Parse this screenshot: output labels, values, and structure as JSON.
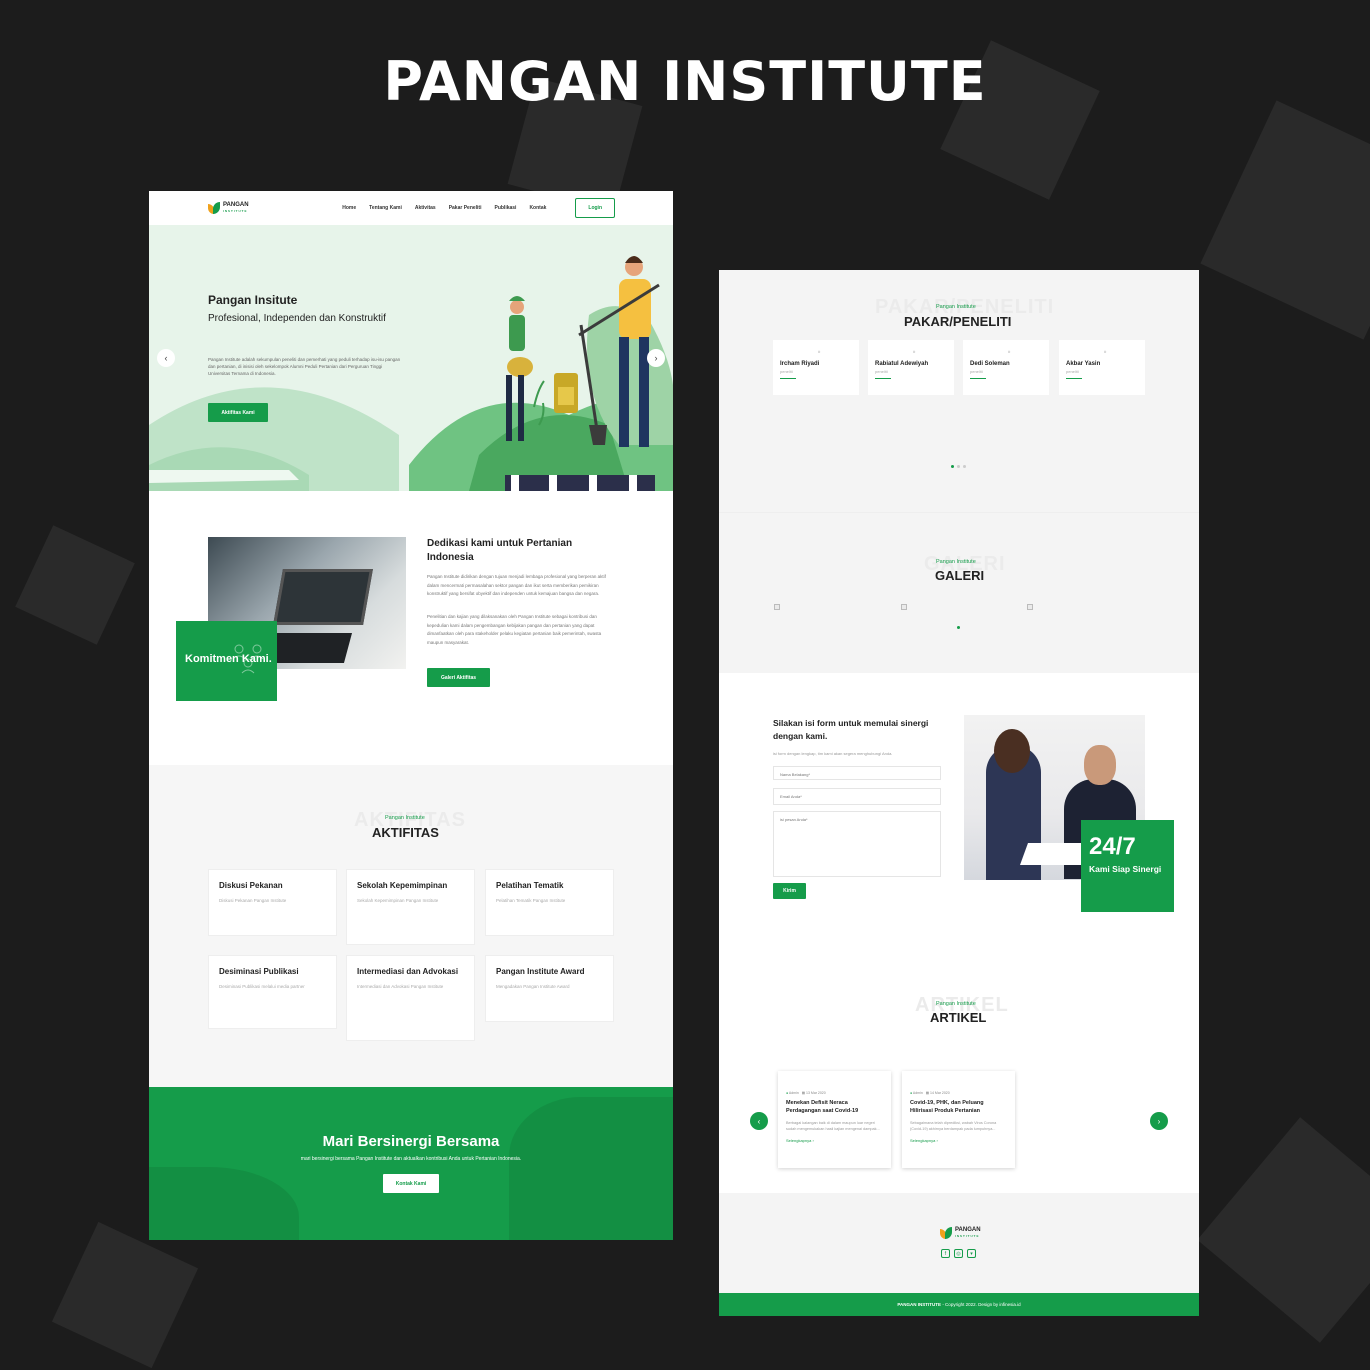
{
  "title": "PANGAN INSTITUTE",
  "nav": {
    "logo": "PANGAN",
    "logo_sub": "INSTITUTE",
    "items": [
      "Home",
      "Tentang Kami",
      "Aktivitas",
      "Pakar Peneliti",
      "Publikasi",
      "Kontak"
    ],
    "login": "Login"
  },
  "hero": {
    "title": "Pangan Insitute",
    "subtitle": "Profesional, Independen dan Konstruktif",
    "body": "Pangan Institute adalah sekumpulan peneliti dan pemerhati yang peduli terhadap isu-isu pangan dan pertanian, di inisisi oleh sekelompok Alumni Peduli Pertanian dari Perguruan Tinggi Universitas Ternama di Indonesia.",
    "button": "Aktifitas Kami"
  },
  "about": {
    "badge": "Komitmen Kami.",
    "title": "Dedikasi kami untuk Pertanian Indonesia",
    "p1": "Pangan Institute didirikan dengan tujuan menjadi lembaga profesional yang berperan aktif dalam mencermati permasalahan sektor pangan dan ikut serta memberikan pemikiran konstruktif yang bersifat obyektif dan independen untuk kemajuan bangsa dan negara.",
    "p2": "Penelitian dan kajian yang dilaksanakan oleh Pangan Institute sebagai kontribusi dan kepedulian kami dalam pengembangan kebijakan pangan dan pertanian yang dapat dimanfaatkan oleh para stakeholder pelaku kegiatan pertanian baik pemerintah, swasta maupun masyarakat.",
    "button": "Galeri Aktifitas"
  },
  "activities": {
    "ghost": "AKTIFITAS",
    "kicker": "Pangan Institute",
    "title": "AKTIFITAS",
    "cards": [
      {
        "title": "Diskusi Pekanan",
        "desc": "Diskusi Pekanan Pangan Institute"
      },
      {
        "title": "Sekolah Kepemimpinan",
        "desc": "Sekolah Kepemimpinan Pangan Institute"
      },
      {
        "title": "Pelatihan Tematik",
        "desc": "Pelatihan Tematik Pangan Institute"
      },
      {
        "title": "Desiminasi Publikasi",
        "desc": "Desiminasi Publikasi melalui media partner"
      },
      {
        "title": "Intermediasi dan Advokasi",
        "desc": "Intermediasi dan Advokasi Pangan Institute"
      },
      {
        "title": "Pangan Institute Award",
        "desc": "Mengadakan Pangan Institute Award"
      }
    ]
  },
  "cta": {
    "title": "Mari Bersinergi Bersama",
    "body": "mari bersinergi bersama Pangan Institute dan aktualkan kontribusi Anda untuk Pertanian Indonesia.",
    "button": "Kontak Kami"
  },
  "experts": {
    "ghost": "PAKAR/PENELITI",
    "kicker": "Pangan Institute",
    "title": "PAKAR/PENELITI",
    "img_alt": "#",
    "role": "peneliti",
    "people": [
      "Ircham Riyadi",
      "Rabiatul Adewiyah",
      "Dedi Soleman",
      "Akbar Yasin"
    ]
  },
  "gallery": {
    "ghost": "GALERI",
    "kicker": "Pangan Institute",
    "title": "GALERI"
  },
  "contact": {
    "title": "Silakan isi form untuk memulai sinergi dengan kami.",
    "subtitle": "isi form dengan lengkap, tim kami akan segera menghubungi Anda.",
    "name_placeholder": "Nama Belakang*",
    "email_placeholder": "Email Anda*",
    "message_placeholder": "isi pesan Anda*",
    "button": "Kirim",
    "badge_big": "24/7",
    "badge_text": "Kami Siap Sinergi"
  },
  "articles": {
    "ghost": "ARTIKEL",
    "kicker": "Pangan Institute",
    "title": "ARTIKEL",
    "items": [
      {
        "author": "Admin",
        "date": "13 Mar 2020",
        "title": "Menekan Defisit Neraca Perdagangan saat Covid-19",
        "excerpt": "Berbagai kalangan baik di dalam maupun luar negeri sudah mengemukakan hasil kajian mengenai dampak...",
        "more": "Selengkapnya ›"
      },
      {
        "author": "Admin",
        "date": "14 Mar 2020",
        "title": "Covid-19, PHK, dan Peluang Hilirisasi Produk Pertanian",
        "excerpt": "Sebagaimana telah diprediksi, wabah Virus Corona (Covid-19) akhirnya berdampak pada lumpuhnya...",
        "more": "Selengkapnya ›"
      }
    ]
  },
  "footer": {
    "logo": "PANGAN",
    "logo_sub": "INSTITUTE",
    "brand": "PANGAN INSTITUTE",
    "copyright": " - Copyright 2022. Design by infinesia.id",
    "social": [
      "f",
      "◎",
      "▾"
    ]
  },
  "colors": {
    "brand": "#159c4a",
    "accent": "#f0a11b",
    "backdrop": "#1c1c1c"
  }
}
